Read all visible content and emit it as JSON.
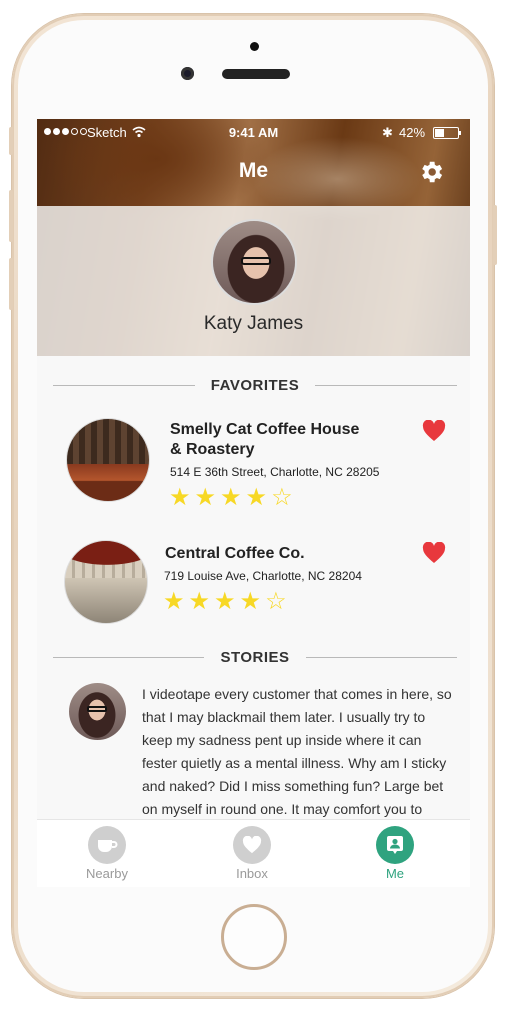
{
  "status_bar": {
    "carrier": "Sketch",
    "time": "9:41 AM",
    "battery": "42%"
  },
  "nav": {
    "title": "Me",
    "settings_icon": "gear-icon"
  },
  "profile": {
    "name": "Katy James"
  },
  "favorites": {
    "header": "FAVORITES",
    "items": [
      {
        "name_line1": "Smelly Cat Coffee House",
        "name_line2": "& Roastery",
        "address": "514 E 36th Street, Charlotte, NC 28205",
        "rating": 4,
        "max_rating": 5,
        "favorited": true
      },
      {
        "name_line1": "Central Coffee Co.",
        "name_line2": "",
        "address": "719 Louise Ave, Charlotte, NC 28204",
        "rating": 4,
        "max_rating": 5,
        "favorited": true
      }
    ]
  },
  "stories": {
    "header": "STORIES",
    "items": [
      {
        "text": "I videotape every customer that comes in here, so that I may blackmail them later. I usually try to keep my sadness pent up inside where it can fester quietly as a mental illness. Why am I sticky and naked? Did I miss something fun? Large bet on myself in round one. It may comfort you to know that Fry's death took only"
      }
    ]
  },
  "tabs": [
    {
      "label": "Nearby",
      "icon": "coffee-cup-icon",
      "active": false
    },
    {
      "label": "Inbox",
      "icon": "heart-icon",
      "active": false
    },
    {
      "label": "Me",
      "icon": "user-card-icon",
      "active": true
    }
  ],
  "colors": {
    "accent": "#2fa37f",
    "heart": "#e8383d",
    "star": "#f7d825"
  }
}
